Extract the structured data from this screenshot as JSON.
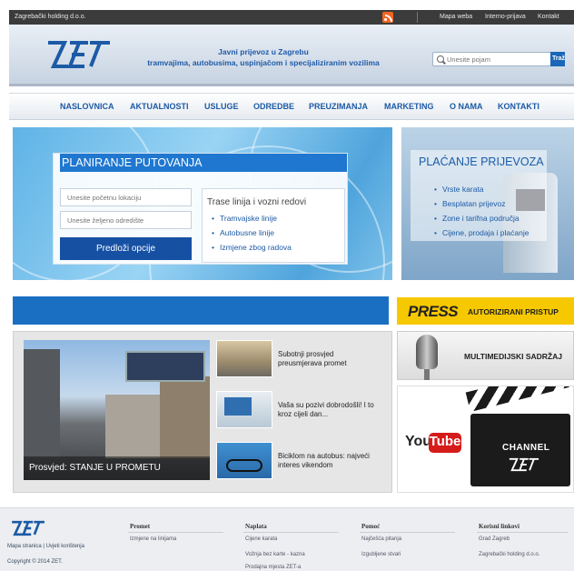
{
  "topbar": {
    "company": "Zagrebački holding d.o.o.",
    "links": [
      "Mapa weba",
      "Interno-prijava",
      "Kontakt"
    ]
  },
  "header": {
    "tagline_line1": "Javni prijevoz u Zagrebu",
    "tagline_line2": "tramvajima, autobusima, uspinjačom i specijaliziranim vozilima",
    "search_placeholder": "Unesite pojam",
    "search_button": "Traži"
  },
  "nav": [
    "NASLOVNICA",
    "AKTUALNOSTI",
    "USLUGE",
    "ODREDBE",
    "PREUZIMANJA",
    "MARKETING",
    "O NAMA",
    "KONTAKTI"
  ],
  "planner": {
    "title": "PLANIRANJE PUTOVANJA",
    "from_placeholder": "Unesite početnu lokaciju",
    "to_placeholder": "Unesite željeno odredište",
    "submit": "Predloži opcije",
    "routes_title": "Trase linija i vozni redovi",
    "routes": [
      "Tramvajske linije",
      "Autobusne linije",
      "Izmjene zbog radova"
    ]
  },
  "payment": {
    "title": "PLAĆANJE PRIJEVOZA",
    "items": [
      "Vrste karata",
      "Besplatan prijevoz",
      "Zone i tarifna područja",
      "Cijene, prodaja i plaćanje"
    ]
  },
  "press": {
    "press": "PRESS",
    "authorized": "AUTORIZIRANI PRISTUP"
  },
  "news": {
    "main_caption": "Prosvjed: STANJE U PROMETU",
    "items": [
      "Subotnji prosvjed preusmjerava promet",
      "Vaša su pozivi dobrodošli! I to kroz cijeli dan...",
      "Biciklom na autobus: najveći interes vikendom"
    ]
  },
  "media": {
    "multimedia": "MULTIMEDIJSKI SADRŽAJ",
    "you": "You",
    "tube": "Tube",
    "channel": "CHANNEL"
  },
  "footer": {
    "links_line": "Mapa stranica | Uvjeti korištenja",
    "copyright": "Copyright © 2014 ZET.",
    "columns": [
      {
        "title": "Promet",
        "items": [
          "Izmjene na linijama"
        ]
      },
      {
        "title": "Naplata",
        "items": [
          "Cijene karata",
          "Vožnja bez karte - kazna",
          "Prodajna mjesta ZET-a"
        ]
      },
      {
        "title": "Pomoć",
        "items": [
          "Najčešća pitanja",
          "Izgubljene stvari"
        ]
      },
      {
        "title": "Korisni linkovi",
        "items": [
          "Grad Zagreb",
          "Zagrebački holding d.o.o."
        ]
      }
    ]
  },
  "colors": {
    "brand_blue": "#1c5aa6",
    "press_yellow": "#f6c800",
    "youtube_red": "#d61b1b"
  }
}
